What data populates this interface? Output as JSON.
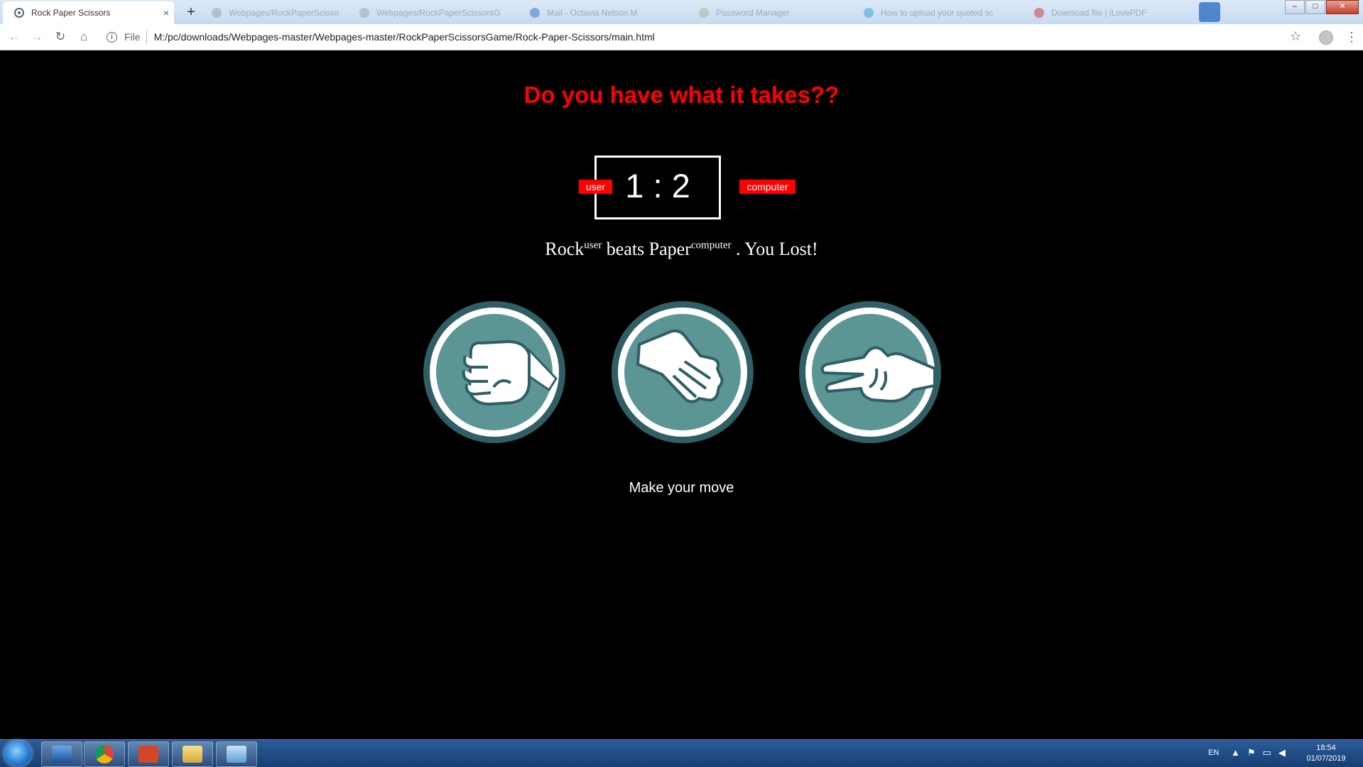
{
  "browser": {
    "active_tab": {
      "title": "Rock Paper Scissors",
      "close": "×"
    },
    "background_tabs": [
      {
        "title": "Webpages/RockPaperScissorsG"
      },
      {
        "title": "Webpages/RockPaperScissorsG"
      },
      {
        "title": "Mail - Octavia Nelson M"
      },
      {
        "title": "Password Manager"
      },
      {
        "title": "How to upload your quoted sc"
      },
      {
        "title": "Download file | iLovePDF"
      }
    ],
    "new_tab": "+",
    "window_controls": {
      "minimize": "–",
      "maximize": "□",
      "close": "✕"
    },
    "nav": {
      "back": "←",
      "forward": "→",
      "reload": "↻",
      "home": "⌂"
    },
    "address": {
      "info": "i",
      "scheme": "File",
      "url": "M:/pc/downloads/Webpages-master/Webpages-master/RockPaperScissorsGame/Rock-Paper-Scissors/main.html"
    },
    "bookmark_star": "☆",
    "menu": "⋮"
  },
  "game": {
    "headline": "Do you have what it takes??",
    "score": {
      "user": 1,
      "separator": ":",
      "computer": 2,
      "text": "1 : 2"
    },
    "labels": {
      "user": "user",
      "computer": "computer"
    },
    "result": {
      "user_choice": "Rock",
      "user_tag": "user",
      "verb": "beats",
      "computer_choice": "Paper",
      "computer_tag": "computer",
      "outcome": ". You Lost!"
    },
    "choices": [
      {
        "id": "rock",
        "icon": "fist-icon"
      },
      {
        "id": "paper",
        "icon": "open-hand-icon"
      },
      {
        "id": "scissors",
        "icon": "peace-sign-icon"
      }
    ],
    "action_message": "Make your move",
    "colors": {
      "headline": "#ff0000",
      "badge": "#ff0000",
      "choice_ring": "#2f5e64",
      "choice_fill": "#5b9594",
      "choice_border": "#ffffff"
    }
  },
  "taskbar": {
    "apps": [
      "windows-explorer-icon",
      "chrome-icon",
      "powerpoint-icon",
      "file-explorer-icon",
      "control-panel-icon"
    ],
    "language": "EN",
    "time": "18:54",
    "date": "01/07/2019"
  }
}
